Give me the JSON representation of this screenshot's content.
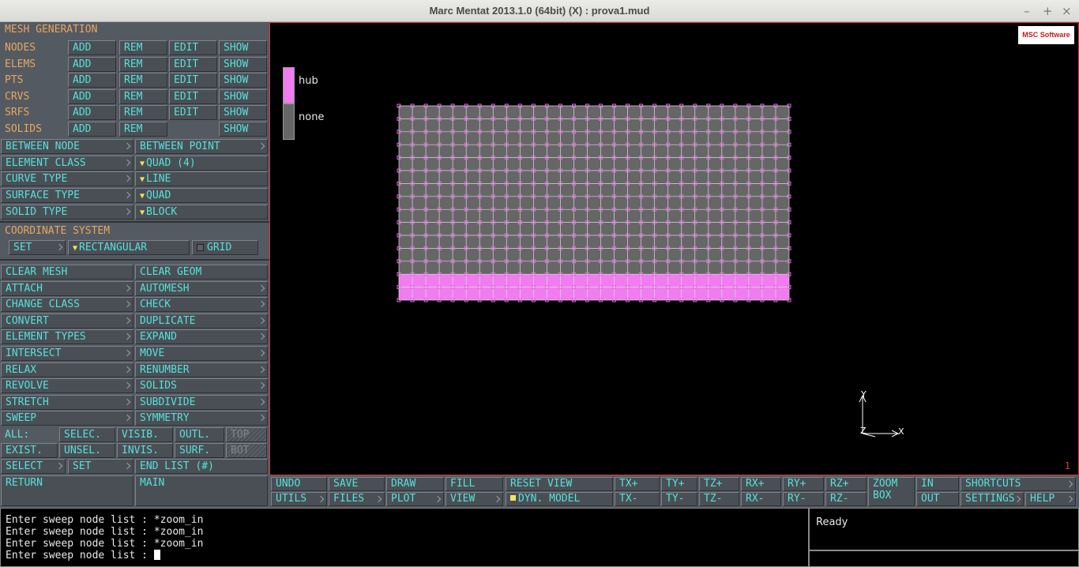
{
  "window": {
    "title": "Marc Mentat 2013.1.0 (64bit) (X) : prova1.mud",
    "minimize": "–",
    "maximize": "+",
    "close": "×"
  },
  "panel": {
    "header": "MESH GENERATION",
    "rows": [
      {
        "label": "NODES",
        "buttons": [
          "ADD",
          "REM",
          "EDIT",
          "SHOW"
        ]
      },
      {
        "label": "ELEMS",
        "buttons": [
          "ADD",
          "REM",
          "EDIT",
          "SHOW"
        ]
      },
      {
        "label": "PTS",
        "buttons": [
          "ADD",
          "REM",
          "EDIT",
          "SHOW"
        ]
      },
      {
        "label": "CRVS",
        "buttons": [
          "ADD",
          "REM",
          "EDIT",
          "SHOW"
        ]
      },
      {
        "label": "SRFS",
        "buttons": [
          "ADD",
          "REM",
          "EDIT",
          "SHOW"
        ]
      },
      {
        "label": "SOLIDS",
        "buttons": [
          "ADD",
          "REM",
          "",
          "SHOW"
        ]
      }
    ],
    "between_node": "BETWEEN NODE",
    "between_point": "BETWEEN POINT",
    "element_class": "ELEMENT CLASS",
    "element_class_value": "QUAD (4)",
    "curve_type": "CURVE TYPE",
    "curve_type_value": "LINE",
    "surface_type": "SURFACE TYPE",
    "surface_type_value": "QUAD",
    "solid_type": "SOLID TYPE",
    "solid_type_value": "BLOCK",
    "coord_header": "COORDINATE SYSTEM",
    "coord_set": "SET",
    "coord_value": "RECTANGULAR",
    "grid": "GRID",
    "tools": [
      [
        "CLEAR MESH",
        "CLEAR GEOM"
      ],
      [
        "ATTACH",
        "AUTOMESH"
      ],
      [
        "CHANGE CLASS",
        "CHECK"
      ],
      [
        "CONVERT",
        "DUPLICATE"
      ],
      [
        "ELEMENT TYPES",
        "EXPAND"
      ],
      [
        "INTERSECT",
        "MOVE"
      ],
      [
        "RELAX",
        "RENUMBER"
      ],
      [
        "REVOLVE",
        "SOLIDS"
      ],
      [
        "STRETCH",
        "SUBDIVIDE"
      ],
      [
        "SWEEP",
        "SYMMETRY"
      ]
    ],
    "all_label": "ALL:",
    "selec": "SELEC.",
    "visib": "VISIB.",
    "outl": "OUTL.",
    "top": "TOP",
    "exist": "EXIST.",
    "unsel": "UNSEL.",
    "invis": "INVIS.",
    "surf": "SURF.",
    "bot": "BOT",
    "select": "SELECT",
    "set": "SET",
    "end_list": "END LIST (#)",
    "return": "RETURN",
    "main": "MAIN"
  },
  "viewport": {
    "logo": "MSC Software",
    "legend": [
      {
        "label": "hub",
        "color": "#f07cf0"
      },
      {
        "label": "none",
        "color": "#666666"
      }
    ],
    "axis_x": "X",
    "axis_y": "Y",
    "axis_z": "Z",
    "page_number": "1",
    "mesh": {
      "cols": 29,
      "rows": 15,
      "hub_rows": 2,
      "element_fill": "#666666",
      "hub_fill": "#f07cf0",
      "node_color": "#e070e0"
    }
  },
  "toolbar": {
    "undo": "UNDO",
    "save": "SAVE",
    "draw": "DRAW",
    "fill": "FILL",
    "utils": "UTILS",
    "files": "FILES",
    "plot": "PLOT",
    "view": "VIEW",
    "reset_view": "RESET VIEW",
    "dyn_model": "DYN. MODEL",
    "tx_plus": "TX+",
    "ty_plus": "TY+",
    "tz_plus": "TZ+",
    "rx_plus": "RX+",
    "ry_plus": "RY+",
    "rz_plus": "RZ+",
    "tx_minus": "TX-",
    "ty_minus": "TY-",
    "tz_minus": "TZ-",
    "rx_minus": "RX-",
    "ry_minus": "RY-",
    "rz_minus": "RZ-",
    "zoom": "ZOOM",
    "box": "BOX",
    "in": "IN",
    "out": "OUT",
    "shortcuts": "SHORTCUTS",
    "settings": "SETTINGS",
    "help": "HELP"
  },
  "console": {
    "lines": [
      "Enter sweep node list : *zoom_in",
      "Enter sweep node list : *zoom_in",
      "Enter sweep node list : *zoom_in"
    ],
    "prompt": "Enter sweep node list : "
  },
  "status": "Ready"
}
